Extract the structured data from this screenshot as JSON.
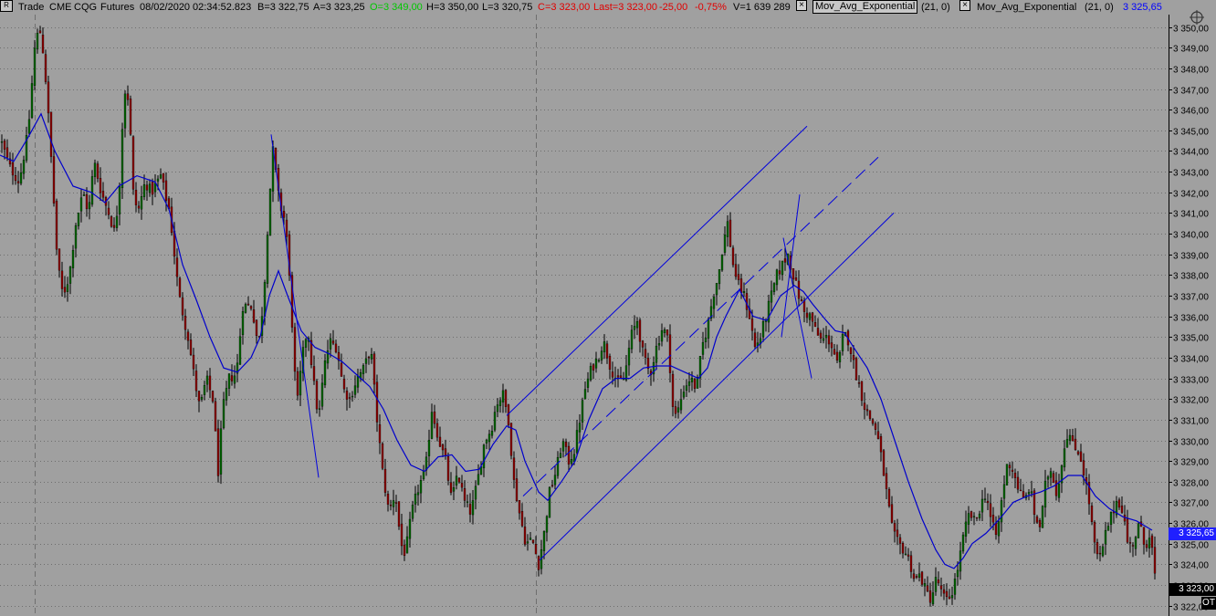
{
  "header": {
    "menu_icon": "R",
    "mode": "Trade",
    "exchange": "CME",
    "symbol": "CQG",
    "type": "Futures",
    "date": "08/02/2020",
    "time": "02:34:52.823",
    "bid": "B=3 322,75",
    "ask": "A=3 323,25",
    "open": "O=3 349,00",
    "high": "H=3 350,00",
    "low": "L=3 320,75",
    "close": "C=3 323,00",
    "last": "Last=3 323,00",
    "change": "-25,00",
    "change_pct": "-0,75%",
    "volume": "V=1 639 289",
    "study1_name": "Mov_Avg_Exponential",
    "study1_params": "(21,  0)",
    "study2_name": "Mov_Avg_Exponential",
    "study2_params": "(21,  0)",
    "study2_value": "3 325,65",
    "close_icon": "×"
  },
  "colors": {
    "background": "#a0a0a0",
    "grid": "#6e6e6e",
    "candle_up": "#006400",
    "candle_down": "#8b0000",
    "wick": "#000000",
    "ema": "#0000cc",
    "trendline": "#0000dd",
    "open_green": "#00c800",
    "close_red": "#e00000",
    "value_blue": "#0000ff",
    "marker_bg": "#2020ff",
    "marker_fg": "#ffffff"
  },
  "markers": {
    "ema_label": "3 325,65",
    "last_label": "3 323,00",
    "ot_label": "OT"
  },
  "chart_data": {
    "type": "candlestick",
    "ylim": [
      3321.5,
      3350.6
    ],
    "y_ticks": [
      "3 350,00",
      "3 349,00",
      "3 348,00",
      "3 347,00",
      "3 346,00",
      "3 345,00",
      "3 344,00",
      "3 343,00",
      "3 342,00",
      "3 341,00",
      "3 340,00",
      "3 339,00",
      "3 338,00",
      "3 337,00",
      "3 336,00",
      "3 335,00",
      "3 334,00",
      "3 333,00",
      "3 332,00",
      "3 331,00",
      "3 330,00",
      "3 329,00",
      "3 328,00",
      "3 327,00",
      "3 326,00",
      "3 325,00",
      "3 324,00",
      "3 323,00",
      "3 322,00"
    ],
    "ema_series": [
      [
        0,
        3343.8
      ],
      [
        15,
        3343.5
      ],
      [
        30,
        3344.6
      ],
      [
        45,
        3345.8
      ],
      [
        60,
        3344
      ],
      [
        80,
        3342.3
      ],
      [
        100,
        3342
      ],
      [
        115,
        3341.5
      ],
      [
        130,
        3342.3
      ],
      [
        150,
        3342.8
      ],
      [
        170,
        3342.5
      ],
      [
        185,
        3341.2
      ],
      [
        200,
        3338.5
      ],
      [
        215,
        3336.8
      ],
      [
        230,
        3335
      ],
      [
        245,
        3333.5
      ],
      [
        260,
        3333.3
      ],
      [
        275,
        3334
      ],
      [
        285,
        3335
      ],
      [
        295,
        3337
      ],
      [
        305,
        3338.2
      ],
      [
        315,
        3337
      ],
      [
        330,
        3335.3
      ],
      [
        345,
        3334.5
      ],
      [
        360,
        3334.2
      ],
      [
        375,
        3333.8
      ],
      [
        390,
        3333.2
      ],
      [
        405,
        3332.6
      ],
      [
        420,
        3331.5
      ],
      [
        435,
        3330
      ],
      [
        450,
        3328.8
      ],
      [
        465,
        3328.5
      ],
      [
        480,
        3329.2
      ],
      [
        495,
        3329.3
      ],
      [
        510,
        3328.5
      ],
      [
        525,
        3328.6
      ],
      [
        540,
        3329.8
      ],
      [
        555,
        3330.7
      ],
      [
        565,
        3330.5
      ],
      [
        575,
        3329
      ],
      [
        590,
        3327.5
      ],
      [
        600,
        3327.1
      ],
      [
        615,
        3328
      ],
      [
        630,
        3329
      ],
      [
        645,
        3331
      ],
      [
        660,
        3332.5
      ],
      [
        675,
        3333
      ],
      [
        690,
        3333
      ],
      [
        705,
        3333.5
      ],
      [
        720,
        3333.6
      ],
      [
        735,
        3333.6
      ],
      [
        750,
        3333.3
      ],
      [
        765,
        3333
      ],
      [
        775,
        3333.5
      ],
      [
        785,
        3335
      ],
      [
        795,
        3336
      ],
      [
        810,
        3337.3
      ],
      [
        825,
        3336
      ],
      [
        840,
        3335.8
      ],
      [
        855,
        3337
      ],
      [
        870,
        3337.5
      ],
      [
        880,
        3337.2
      ],
      [
        890,
        3336.6
      ],
      [
        905,
        3335.8
      ],
      [
        915,
        3335.3
      ],
      [
        925,
        3335.2
      ],
      [
        935,
        3334.5
      ],
      [
        950,
        3333.5
      ],
      [
        965,
        3332
      ],
      [
        980,
        3330
      ],
      [
        995,
        3328
      ],
      [
        1010,
        3326.2
      ],
      [
        1025,
        3324.7
      ],
      [
        1035,
        3324
      ],
      [
        1045,
        3323.8
      ],
      [
        1055,
        3324.3
      ],
      [
        1065,
        3325
      ],
      [
        1080,
        3325.5
      ],
      [
        1095,
        3326.2
      ],
      [
        1110,
        3327
      ],
      [
        1125,
        3327.3
      ],
      [
        1140,
        3327.5
      ],
      [
        1155,
        3327.8
      ],
      [
        1170,
        3328.3
      ],
      [
        1185,
        3328.3
      ],
      [
        1200,
        3327.3
      ],
      [
        1215,
        3326.7
      ],
      [
        1230,
        3326.3
      ],
      [
        1245,
        3326.1
      ],
      [
        1262,
        3325.65
      ]
    ],
    "trend_lines": [
      {
        "style": "solid",
        "x1": 555,
        "y1": 3331.2,
        "x2": 884,
        "y2": 3345.2
      },
      {
        "style": "dashed",
        "x1": 573,
        "y1": 3327.3,
        "x2": 962,
        "y2": 3343.7
      },
      {
        "style": "solid",
        "x1": 591,
        "y1": 3324.2,
        "x2": 979,
        "y2": 3341.0
      },
      {
        "style": "solid",
        "x1": 297,
        "y1": 3344.8,
        "x2": 349,
        "y2": 3328.2
      },
      {
        "style": "solid",
        "x1": 876,
        "y1": 3341.9,
        "x2": 856,
        "y2": 3335.0
      },
      {
        "style": "solid",
        "x1": 858,
        "y1": 3339.8,
        "x2": 889,
        "y2": 3333.0
      }
    ],
    "price_path": [
      [
        0,
        3344.5
      ],
      [
        10,
        3343.2
      ],
      [
        20,
        3342.5
      ],
      [
        30,
        3345
      ],
      [
        38,
        3349.5
      ],
      [
        44,
        3349.8
      ],
      [
        50,
        3347
      ],
      [
        56,
        3343
      ],
      [
        62,
        3338.5
      ],
      [
        68,
        3337
      ],
      [
        75,
        3338
      ],
      [
        82,
        3340.5
      ],
      [
        90,
        3342
      ],
      [
        96,
        3341
      ],
      [
        102,
        3343.5
      ],
      [
        110,
        3342
      ],
      [
        118,
        3341
      ],
      [
        125,
        3340
      ],
      [
        130,
        3342.5
      ],
      [
        135,
        3347
      ],
      [
        140,
        3346.5
      ],
      [
        145,
        3342
      ],
      [
        150,
        3341
      ],
      [
        158,
        3342.5
      ],
      [
        165,
        3342
      ],
      [
        175,
        3342.8
      ],
      [
        185,
        3341
      ],
      [
        195,
        3337
      ],
      [
        205,
        3335
      ],
      [
        212,
        3333
      ],
      [
        218,
        3331.5
      ],
      [
        225,
        3333
      ],
      [
        232,
        3332
      ],
      [
        238,
        3328.5
      ],
      [
        243,
        3331.5
      ],
      [
        250,
        3333
      ],
      [
        258,
        3333.2
      ],
      [
        265,
        3336.5
      ],
      [
        275,
        3336.5
      ],
      [
        282,
        3334.5
      ],
      [
        288,
        3337
      ],
      [
        293,
        3341
      ],
      [
        298,
        3344
      ],
      [
        305,
        3341.5
      ],
      [
        312,
        3340.5
      ],
      [
        318,
        3336.5
      ],
      [
        324,
        3331.5
      ],
      [
        330,
        3334
      ],
      [
        336,
        3335.5
      ],
      [
        342,
        3333
      ],
      [
        348,
        3331
      ],
      [
        354,
        3333.5
      ],
      [
        360,
        3334.8
      ],
      [
        368,
        3334.5
      ],
      [
        375,
        3332.5
      ],
      [
        382,
        3332
      ],
      [
        390,
        3333
      ],
      [
        398,
        3333.5
      ],
      [
        405,
        3334.5
      ],
      [
        412,
        3331
      ],
      [
        418,
        3328.5
      ],
      [
        425,
        3326.5
      ],
      [
        432,
        3327.5
      ],
      [
        438,
        3325
      ],
      [
        443,
        3324.5
      ],
      [
        450,
        3326.5
      ],
      [
        458,
        3327.8
      ],
      [
        465,
        3328.5
      ],
      [
        472,
        3331.5
      ],
      [
        480,
        3330
      ],
      [
        487,
        3329
      ],
      [
        494,
        3327
      ],
      [
        500,
        3328.5
      ],
      [
        508,
        3327
      ],
      [
        515,
        3326.5
      ],
      [
        522,
        3328
      ],
      [
        530,
        3330
      ],
      [
        537,
        3330.5
      ],
      [
        543,
        3331.8
      ],
      [
        550,
        3332.2
      ],
      [
        556,
        3331
      ],
      [
        562,
        3328
      ],
      [
        568,
        3326.5
      ],
      [
        575,
        3325
      ],
      [
        582,
        3325.2
      ],
      [
        589,
        3324
      ],
      [
        595,
        3325.5
      ],
      [
        601,
        3327.5
      ],
      [
        608,
        3328.5
      ],
      [
        615,
        3330
      ],
      [
        622,
        3329
      ],
      [
        628,
        3329.5
      ],
      [
        634,
        3331
      ],
      [
        640,
        3332.5
      ],
      [
        647,
        3333.5
      ],
      [
        654,
        3334
      ],
      [
        660,
        3334.8
      ],
      [
        668,
        3333.5
      ],
      [
        676,
        3332.8
      ],
      [
        683,
        3333
      ],
      [
        690,
        3335
      ],
      [
        697,
        3335.8
      ],
      [
        704,
        3334
      ],
      [
        711,
        3333.2
      ],
      [
        718,
        3334.5
      ],
      [
        725,
        3335.5
      ],
      [
        731,
        3334.8
      ],
      [
        737,
        3331
      ],
      [
        742,
        3331.5
      ],
      [
        748,
        3332.5
      ],
      [
        755,
        3333
      ],
      [
        762,
        3332.5
      ],
      [
        768,
        3334.5
      ],
      [
        774,
        3335.5
      ],
      [
        780,
        3337
      ],
      [
        786,
        3338
      ],
      [
        791,
        3339.5
      ],
      [
        796,
        3340.5
      ],
      [
        802,
        3338.5
      ],
      [
        808,
        3337.5
      ],
      [
        814,
        3337
      ],
      [
        820,
        3336
      ],
      [
        826,
        3334.5
      ],
      [
        832,
        3335
      ],
      [
        838,
        3336
      ],
      [
        844,
        3337
      ],
      [
        850,
        3338
      ],
      [
        856,
        3338.5
      ],
      [
        862,
        3339
      ],
      [
        868,
        3338
      ],
      [
        874,
        3337
      ],
      [
        880,
        3336.2
      ],
      [
        887,
        3336
      ],
      [
        893,
        3335.2
      ],
      [
        899,
        3334.8
      ],
      [
        905,
        3335
      ],
      [
        911,
        3334.5
      ],
      [
        917,
        3333.5
      ],
      [
        923,
        3335.2
      ],
      [
        929,
        3334.8
      ],
      [
        935,
        3333.5
      ],
      [
        941,
        3332.5
      ],
      [
        947,
        3331.5
      ],
      [
        953,
        3331
      ],
      [
        959,
        3330.5
      ],
      [
        965,
        3329
      ],
      [
        971,
        3327.2
      ],
      [
        977,
        3325.5
      ],
      [
        983,
        3325
      ],
      [
        989,
        3324.7
      ],
      [
        995,
        3324.2
      ],
      [
        1001,
        3323.2
      ],
      [
        1007,
        3323.5
      ],
      [
        1013,
        3322.7
      ],
      [
        1019,
        3322.3
      ],
      [
        1025,
        3323.4
      ],
      [
        1031,
        3322.5
      ],
      [
        1037,
        3322.2
      ],
      [
        1043,
        3322.8
      ],
      [
        1049,
        3324
      ],
      [
        1055,
        3325.5
      ],
      [
        1061,
        3326.5
      ],
      [
        1067,
        3326
      ],
      [
        1073,
        3326.8
      ],
      [
        1079,
        3327.5
      ],
      [
        1085,
        3326
      ],
      [
        1091,
        3325.3
      ],
      [
        1097,
        3327.4
      ],
      [
        1103,
        3329
      ],
      [
        1109,
        3328.5
      ],
      [
        1115,
        3327.6
      ],
      [
        1121,
        3327
      ],
      [
        1127,
        3327.8
      ],
      [
        1133,
        3326.2
      ],
      [
        1139,
        3325.8
      ],
      [
        1145,
        3328.2
      ],
      [
        1151,
        3328.6
      ],
      [
        1157,
        3327.3
      ],
      [
        1163,
        3329.3
      ],
      [
        1169,
        3330.5
      ],
      [
        1175,
        3329.6
      ],
      [
        1181,
        3329.5
      ],
      [
        1187,
        3328.3
      ],
      [
        1193,
        3326.7
      ],
      [
        1199,
        3324.5
      ],
      [
        1205,
        3324.3
      ],
      [
        1211,
        3325.7
      ],
      [
        1217,
        3326.4
      ],
      [
        1223,
        3327.2
      ],
      [
        1229,
        3326.6
      ],
      [
        1235,
        3324.8
      ],
      [
        1241,
        3325.1
      ],
      [
        1247,
        3326
      ],
      [
        1253,
        3324.8
      ],
      [
        1259,
        3325.6
      ],
      [
        1265,
        3323
      ]
    ]
  }
}
